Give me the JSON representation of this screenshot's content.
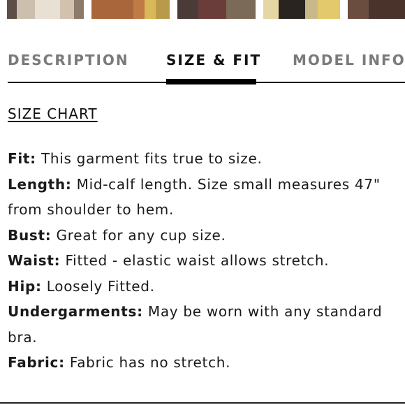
{
  "thumbnails": [
    {
      "name": "product-photo-1"
    },
    {
      "name": "product-photo-2"
    },
    {
      "name": "product-photo-3"
    },
    {
      "name": "product-photo-4"
    },
    {
      "name": "product-photo-5"
    }
  ],
  "tabs": {
    "description": "DESCRIPTION",
    "size_fit": "SIZE & FIT",
    "model_info": "MODEL INFO",
    "active": "size_fit"
  },
  "size_chart_label": "SIZE CHART",
  "specs": [
    {
      "label": "Fit:",
      "text": "This garment fits true to size."
    },
    {
      "label": "Length:",
      "text": "Mid-calf length. Size small measures 47\" from shoulder to hem."
    },
    {
      "label": "Bust:",
      "text": "Great for any cup size."
    },
    {
      "label": "Waist:",
      "text": "Fitted - elastic waist allows stretch."
    },
    {
      "label": "Hip:",
      "text": "Loosely Fitted."
    },
    {
      "label": "Undergarments:",
      "text": "May be worn with any standard bra."
    },
    {
      "label": "Fabric:",
      "text": "Fabric has no stretch."
    }
  ],
  "colors": {
    "text": "#111111",
    "inactive_tab": "#7a7a7a",
    "indicator": "#000000"
  }
}
